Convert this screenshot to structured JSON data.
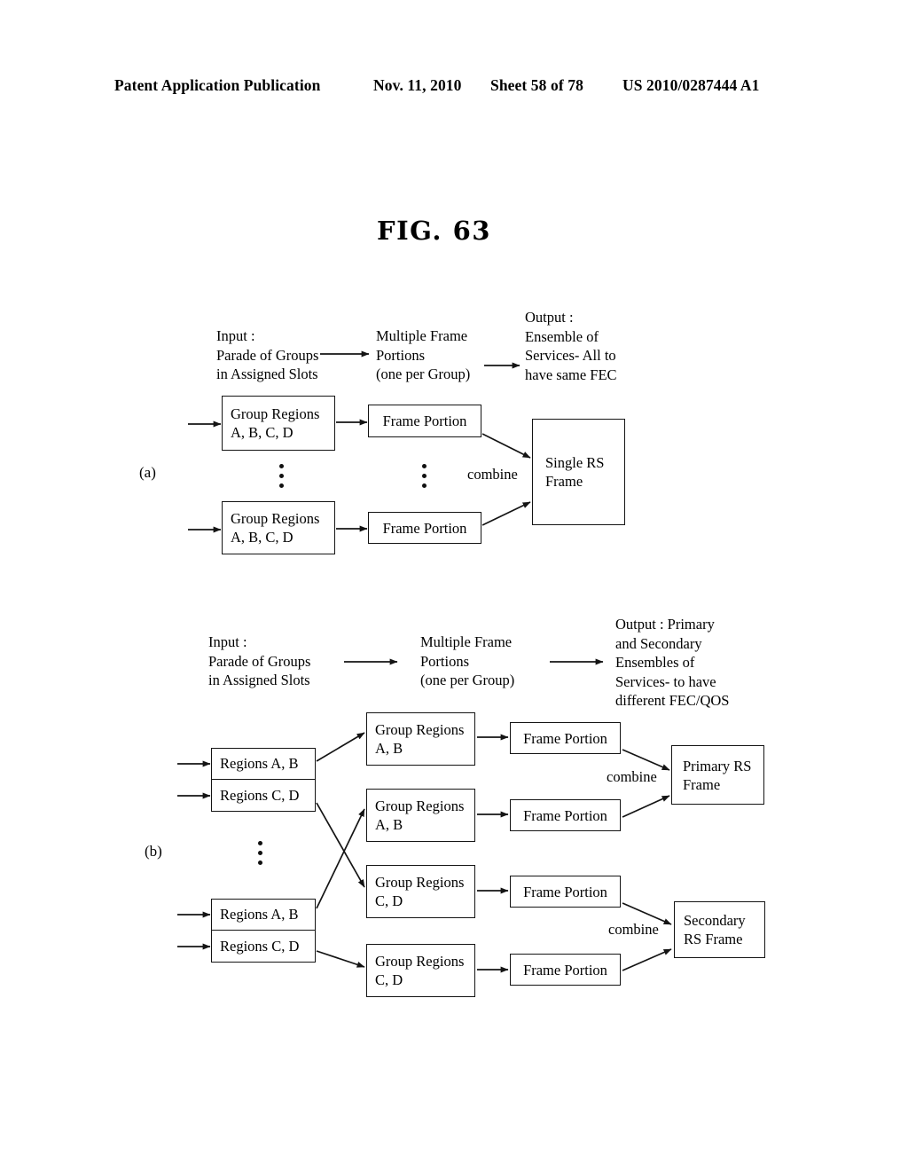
{
  "header": {
    "publication": "Patent Application Publication",
    "date": "Nov. 11, 2010",
    "sheet": "Sheet 58 of 78",
    "number": "US 2010/0287444 A1"
  },
  "figure": {
    "title": "FIG.  63"
  },
  "panel_a": {
    "label": "(a)",
    "flow_headers": {
      "input": "Input :\nParade of Groups\nin Assigned Slots",
      "middle": "Multiple Frame\nPortions\n(one per Group)",
      "output": "Output :\nEnsemble of\nServices- All to\nhave same FEC"
    },
    "boxes": {
      "group_regions_top": "Group Regions\nA, B, C, D",
      "frame_portion_top": "Frame Portion",
      "group_regions_bottom": "Group Regions\nA, B, C, D",
      "frame_portion_bottom": "Frame Portion",
      "rs_frame": "Single RS\nFrame"
    },
    "combine_label": "combine"
  },
  "panel_b": {
    "label": "(b)",
    "flow_headers": {
      "input": "Input :\nParade of Groups\nin Assigned Slots",
      "middle": "Multiple Frame\nPortions\n(one per Group)",
      "output": "Output : Primary\nand Secondary\nEnsembles of\nServices- to have\ndifferent FEC/QOS"
    },
    "regions_block_top": {
      "row1": "Regions A, B",
      "row2": "Regions C, D"
    },
    "regions_block_bottom": {
      "row1": "Regions A, B",
      "row2": "Regions C, D"
    },
    "group_regions": [
      "Group Regions\nA, B",
      "Group Regions\nA, B",
      "Group Regions\nC, D",
      "Group Regions\nC, D"
    ],
    "frame_portions": [
      "Frame Portion",
      "Frame Portion",
      "Frame Portion",
      "Frame Portion"
    ],
    "combine_labels": {
      "primary": "combine",
      "secondary": "combine"
    },
    "rs_frames": {
      "primary": "Primary RS\nFrame",
      "secondary": "Secondary\nRS Frame"
    }
  },
  "colors": {
    "ink": "#141414",
    "paper": "#ffffff"
  }
}
